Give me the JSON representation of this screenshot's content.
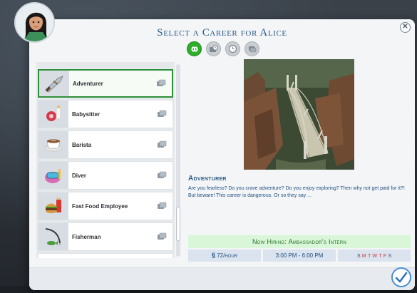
{
  "dialog": {
    "title": "Select a Career for Alice"
  },
  "filters": [
    {
      "name": "all-careers",
      "icon": "infinity-icon",
      "active": true
    },
    {
      "name": "full-time",
      "icon": "full-time-icon",
      "active": false
    },
    {
      "name": "part-time",
      "icon": "part-time-icon",
      "active": false
    },
    {
      "name": "odd-jobs",
      "icon": "odd-job-icon",
      "active": false
    }
  ],
  "careers": [
    {
      "name": "Adventurer",
      "icon": "machete-icon",
      "selected": true
    },
    {
      "name": "Babysitter",
      "icon": "baby-bottle-icon",
      "selected": false
    },
    {
      "name": "Barista",
      "icon": "coffee-cup-icon",
      "selected": false
    },
    {
      "name": "Diver",
      "icon": "diving-mask-icon",
      "selected": false
    },
    {
      "name": "Fast Food Employee",
      "icon": "fast-food-icon",
      "selected": false
    },
    {
      "name": "Fisherman",
      "icon": "fishing-rod-icon",
      "selected": false
    }
  ],
  "details": {
    "career_title": "Adventurer",
    "description": "Are you fearless? Do you crave adventure? Do you enjoy exploring? Then why not get paid for it?! But beware! This career is dangerous. Or so they say ...",
    "hiring": "Now Hiring: Ambassador's Intern",
    "pay_symbol": "§",
    "pay_amount": "72",
    "pay_unit": "/hour",
    "hours": "3:00 PM - 6:00 PM",
    "days": [
      "S",
      "M",
      "T",
      "W",
      "T",
      "F",
      "S"
    ],
    "work_days": [
      false,
      true,
      true,
      true,
      true,
      true,
      false
    ]
  },
  "colors": {
    "accent": "#2c5a86",
    "selection": "#2f8f3a",
    "hiring_bg": "#d9f7d8",
    "active_filter": "#2eae2a"
  }
}
